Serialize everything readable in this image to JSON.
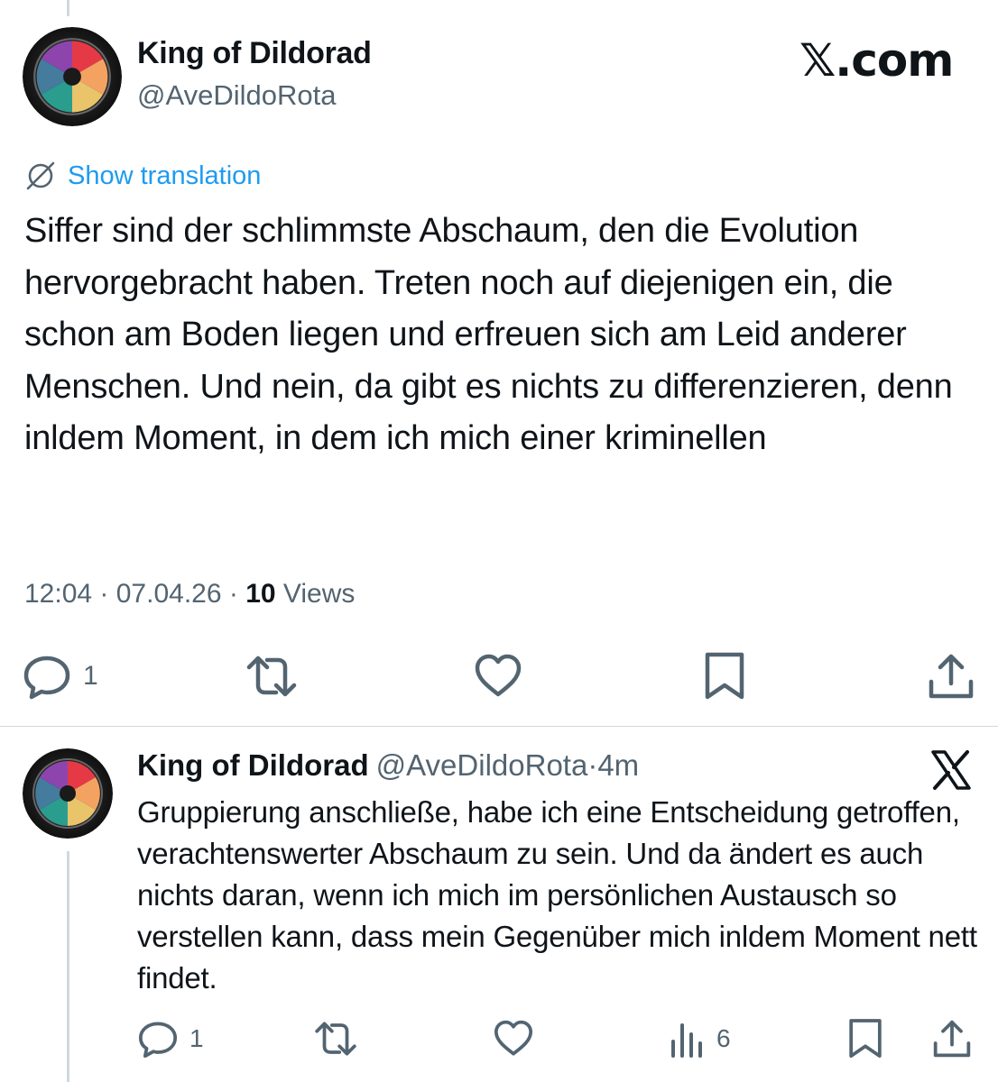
{
  "tweet": {
    "author_name": "King of Dildorad",
    "author_handle": "@AveDildoRota",
    "brand": "𝕏.com",
    "translate_label": "Show translation",
    "text": "Siffer sind der schlimmste Abschaum, den die Evolution hervorgebracht haben. Treten noch auf diejenigen ein, die schon am Boden liegen und erfreuen sich am Leid anderer Menschen. Und nein, da gibt es nichts zu differenzieren, denn inldem Moment, in dem ich mich einer kriminellen",
    "time": "12:04",
    "date": "07.04.26",
    "views_count": "10",
    "views_label": "Views",
    "reply_count": "1"
  },
  "reply": {
    "author_name": "King of Dildorad",
    "author_handle": "@AveDildoRota",
    "separator": "·",
    "time_ago": "4m",
    "text": "Gruppierung anschließe, habe ich eine Entscheidung getroffen, verachtenswerter Abschaum zu sein. Und da ändert es auch nichts daran, wenn ich mich im persönlichen Austausch so verstellen kann, dass mein Gegenüber mich inldem Moment nett findet.",
    "reply_count": "1",
    "views_count": "6"
  },
  "colors": {
    "text": "#0f1419",
    "secondary": "#536471",
    "link": "#1d9bf0",
    "divider": "#cfd9de"
  },
  "icons": [
    "translate-icon",
    "reply-icon",
    "retweet-icon",
    "like-icon",
    "bookmark-icon",
    "share-icon",
    "views-icon",
    "x-logo-icon"
  ]
}
